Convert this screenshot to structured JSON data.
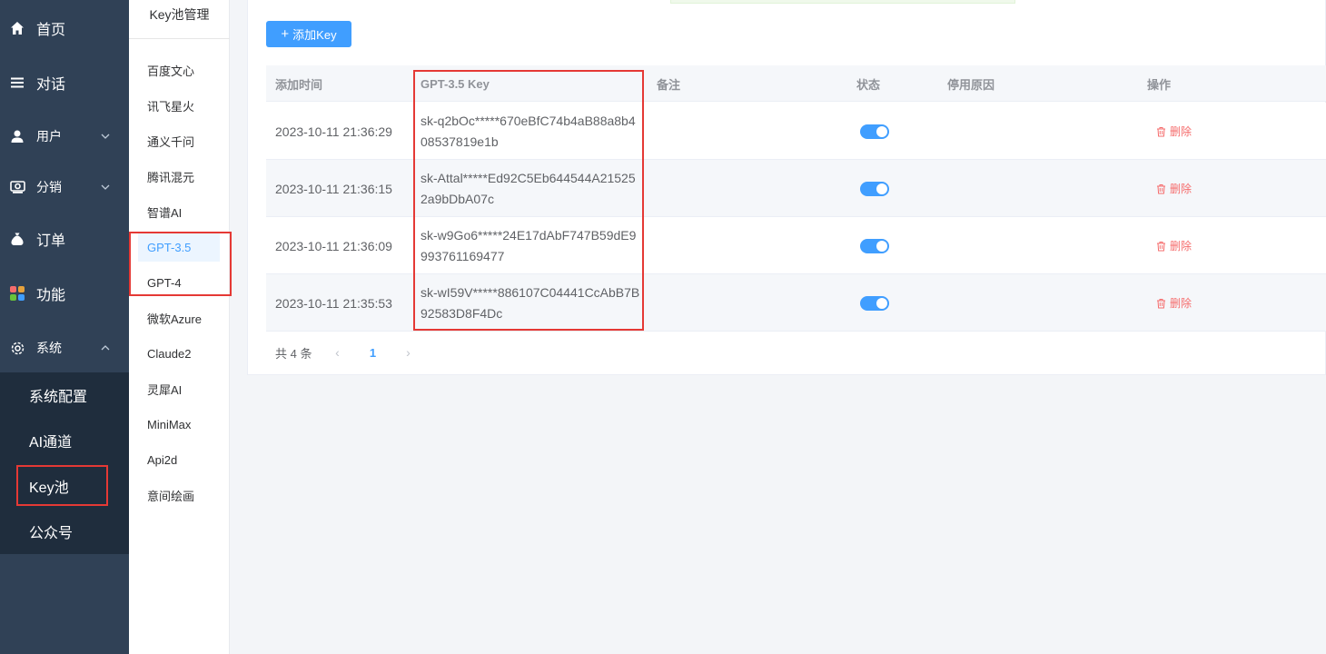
{
  "sidebar": {
    "items": [
      {
        "label": "首页",
        "icon": "home-icon"
      },
      {
        "label": "对话",
        "icon": "list-icon"
      },
      {
        "label": "用户",
        "icon": "user-icon"
      },
      {
        "label": "分销",
        "icon": "distribution-icon"
      },
      {
        "label": "订单",
        "icon": "money-bag-icon"
      },
      {
        "label": "功能",
        "icon": "apps-icon"
      },
      {
        "label": "系统",
        "icon": "gear-icon"
      }
    ],
    "submenu": [
      "系统配置",
      "AI通道",
      "Key池",
      "公众号"
    ]
  },
  "panel2": {
    "title": "Key池管理",
    "items": [
      "百度文心",
      "讯飞星火",
      "通义千问",
      "腾讯混元",
      "智谱AI",
      "GPT-3.5",
      "GPT-4",
      "微软Azure",
      "Claude2",
      "灵犀AI",
      "MiniMax",
      "Api2d",
      "意间绘画"
    ]
  },
  "toolbar": {
    "add_label": "添加Key"
  },
  "table": {
    "headers": [
      "添加时间",
      "GPT-3.5 Key",
      "备注",
      "状态",
      "停用原因",
      "操作"
    ],
    "rows": [
      {
        "time": "2023-10-11 21:36:29",
        "key": "sk-q2bOc*****670eBfC74b4aB88a8b408537819e1b",
        "note": "",
        "enabled": true,
        "reason": "",
        "action": "删除"
      },
      {
        "time": "2023-10-11 21:36:15",
        "key": "sk-Attal*****Ed92C5Eb644544A215252a9bDbA07c",
        "note": "",
        "enabled": true,
        "reason": "",
        "action": "删除"
      },
      {
        "time": "2023-10-11 21:36:09",
        "key": "sk-w9Go6*****24E17dAbF747B59dE9993761169477",
        "note": "",
        "enabled": true,
        "reason": "",
        "action": "删除"
      },
      {
        "time": "2023-10-11 21:35:53",
        "key": "sk-wI59V*****886107C04441CcAbB7B92583D8F4Dc",
        "note": "",
        "enabled": true,
        "reason": "",
        "action": "删除"
      }
    ]
  },
  "pagination": {
    "total": "共 4 条",
    "current": "1"
  },
  "colors": {
    "sidebar": "#304156",
    "submenu": "#1f2d3d",
    "primary": "#409eff",
    "danger": "#f56c6c",
    "highlight": "#e53935"
  }
}
